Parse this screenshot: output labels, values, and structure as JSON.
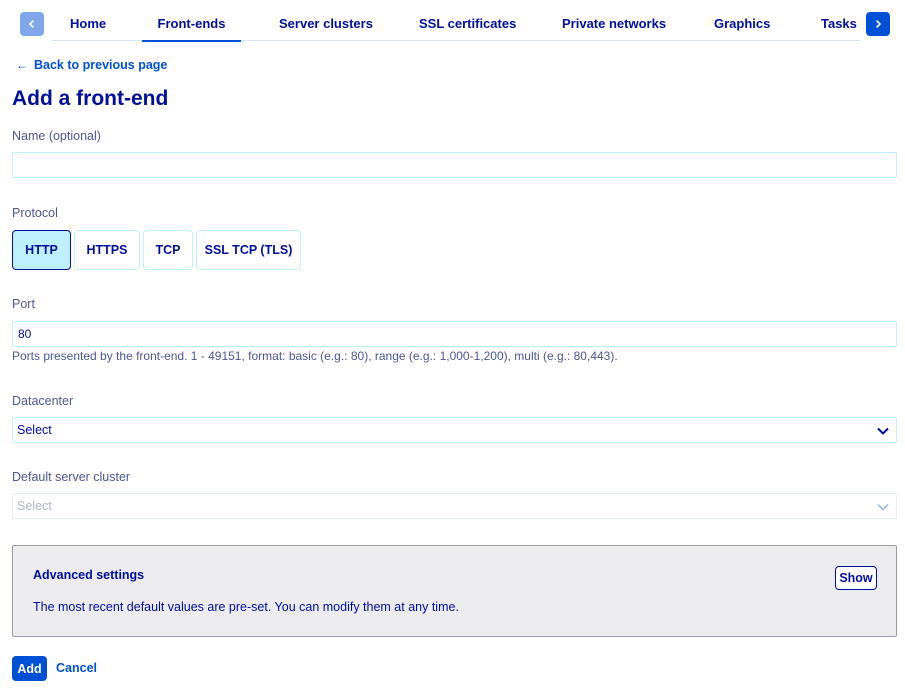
{
  "tabs": {
    "items": [
      {
        "label": "Home"
      },
      {
        "label": "Front-ends"
      },
      {
        "label": "Server clusters"
      },
      {
        "label": "SSL certificates"
      },
      {
        "label": "Private networks"
      },
      {
        "label": "Graphics"
      },
      {
        "label": "Tasks"
      }
    ],
    "active": "Front-ends"
  },
  "back_link": {
    "arrow": "←",
    "label": "Back to previous page"
  },
  "page_title": "Add a front-end",
  "name_field": {
    "label": "Name (optional)",
    "value": ""
  },
  "protocol": {
    "label": "Protocol",
    "options": [
      "HTTP",
      "HTTPS",
      "TCP",
      "SSL TCP (TLS)"
    ],
    "selected": "HTTP"
  },
  "port": {
    "label": "Port",
    "value": "80",
    "help": "Ports presented by the front-end. 1 - 49151, format: basic (e.g.: 80), range (e.g.: 1,000-1,200), multi (e.g.: 80,443)."
  },
  "datacenter": {
    "label": "Datacenter",
    "value": "Select"
  },
  "default_cluster": {
    "label": "Default server cluster",
    "value": "Select",
    "disabled": true
  },
  "advanced": {
    "title": "Advanced settings",
    "description": "The most recent default values are pre-set. You can modify them at any time.",
    "show_label": "Show"
  },
  "actions": {
    "add_label": "Add",
    "cancel_label": "Cancel"
  },
  "colors": {
    "primary": "#0050d7",
    "text": "#000e9c",
    "selected_bg": "#bef1ff"
  }
}
